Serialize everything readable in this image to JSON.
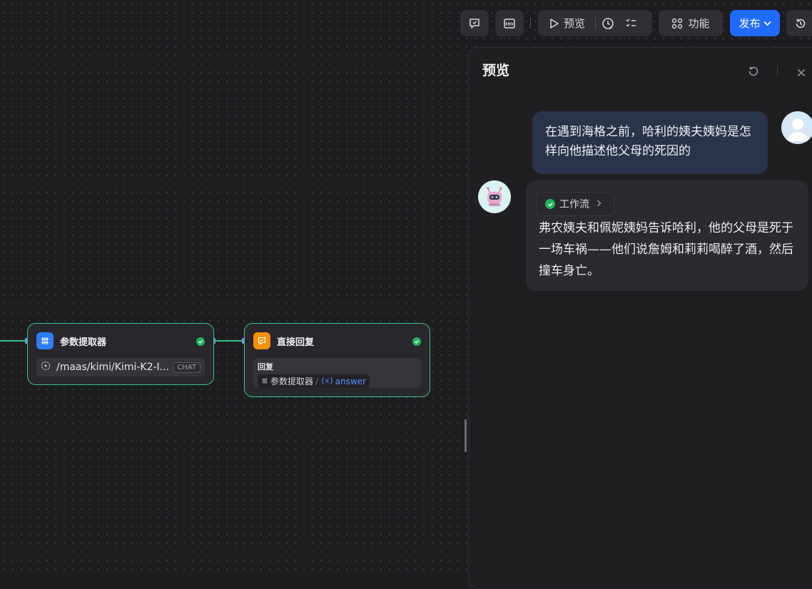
{
  "toolbar": {
    "preview_label": "预览",
    "features_label": "功能",
    "publish_label": "发布",
    "accent_color": "#1f6bff"
  },
  "nodes": {
    "param_extractor": {
      "title": "参数提取器",
      "model_name": "/maas/kimi/Kimi-K2-I...",
      "model_tag": "CHAT",
      "icon_color": "#2f7cf6"
    },
    "direct_reply": {
      "title": "直接回复",
      "reply_label": "回复",
      "var_source": "参数提取器",
      "var_sep": "/",
      "var_symbol": "{x}",
      "var_name": "answer",
      "icon_color": "#f79009"
    }
  },
  "panel": {
    "title": "预览",
    "messages": {
      "user_text": "在遇到海格之前，哈利的姨夫姨妈是怎样向他描述他父母的死因的",
      "workflow_label": "工作流",
      "bot_text": "弗农姨夫和佩妮姨妈告诉哈利，他的父母是死于一场车祸——他们说詹姆和莉莉喝醉了酒，然后撞车身亡。"
    }
  },
  "status_color": "#22b35e",
  "edge_color": "#3bbf88"
}
